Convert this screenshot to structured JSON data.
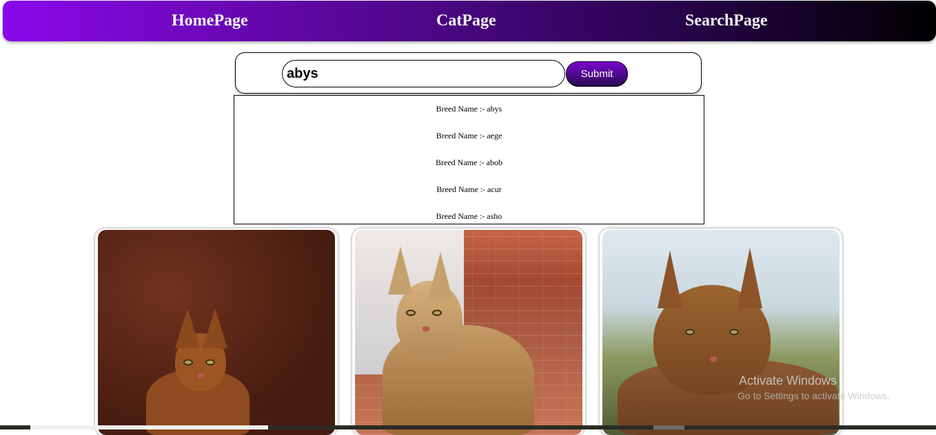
{
  "nav": {
    "items": [
      {
        "label": "HomePage"
      },
      {
        "label": "CatPage"
      },
      {
        "label": "SearchPage"
      }
    ]
  },
  "search": {
    "value": "abys",
    "submit_label": "Submit"
  },
  "suggestions": [
    {
      "label": "Breed Name :- abys"
    },
    {
      "label": "Breed Name :- aege"
    },
    {
      "label": "Breed Name :- abob"
    },
    {
      "label": "Breed Name :- acur"
    },
    {
      "label": "Breed Name :- asho"
    }
  ],
  "cards": [
    {
      "image_subject": "abyssinian-cat-on-brown-couch"
    },
    {
      "image_subject": "abyssinian-cat-in-front-of-brick-building"
    },
    {
      "image_subject": "abyssinian-cat-closeup-outdoors"
    }
  ],
  "watermark": {
    "title": "Activate Windows",
    "subtitle": "Go to Settings to activate Windows."
  },
  "colors": {
    "nav_gradient_start": "#8a08ea",
    "nav_gradient_end": "#000000",
    "button_gradient_start": "#7a05d0",
    "button_gradient_end": "#2a0b4f"
  }
}
